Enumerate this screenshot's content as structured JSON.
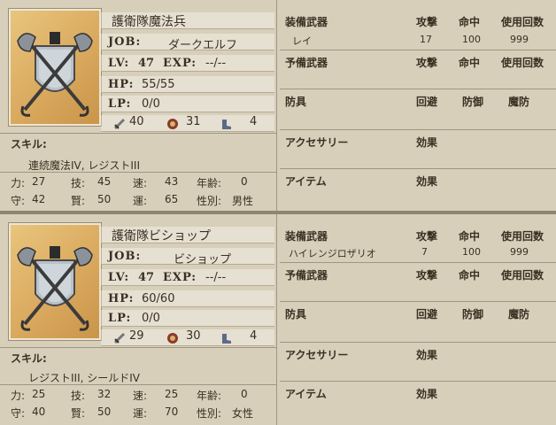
{
  "units": [
    {
      "name": "護衛隊魔法兵",
      "job_label": "JOB:",
      "job": "ダークエルフ",
      "lv_label": "LV:",
      "lv": "47",
      "exp_label": "EXP:",
      "exp": "--/--",
      "hp_label": "HP:",
      "hp": "55/55",
      "lp_label": "LP:",
      "lp": "0/0",
      "atk_icon": "sword-icon",
      "atk": "40",
      "def_icon": "shield-icon",
      "def": "31",
      "move_icon": "boot-icon",
      "move": "4",
      "skill_label": "スキル:",
      "skills": "連続魔法IV, レジストIII",
      "stats": {
        "str_label": "力:",
        "str": "27",
        "tech_label": "技:",
        "tech": "45",
        "spd_label": "速:",
        "spd": "43",
        "age_label": "年齢:",
        "age": "0",
        "def_label": "守:",
        "def": "42",
        "int_label": "賢:",
        "int": "50",
        "luck_label": "運:",
        "luck": "65",
        "sex_label": "性別:",
        "sex": "男性"
      },
      "equip": {
        "weapon_h": "装備武器",
        "atk_h": "攻撃",
        "hit_h": "命中",
        "uses_h": "使用回数",
        "weapon": "レイ",
        "weapon_atk": "17",
        "weapon_hit": "100",
        "weapon_uses": "999",
        "spare_h": "予備武器",
        "spare_atk_h": "攻撃",
        "spare_hit_h": "命中",
        "spare_uses_h": "使用回数",
        "armor_h": "防具",
        "evade_h": "回避",
        "defense_h": "防御",
        "mdef_h": "魔防",
        "acc_h": "アクセサリー",
        "acc_eff_h": "効果",
        "item_h": "アイテム",
        "item_eff_h": "効果"
      }
    },
    {
      "name": "護衛隊ビショップ",
      "job_label": "JOB:",
      "job": "ビショップ",
      "lv_label": "LV:",
      "lv": "47",
      "exp_label": "EXP:",
      "exp": "--/--",
      "hp_label": "HP:",
      "hp": "60/60",
      "lp_label": "LP:",
      "lp": "0/0",
      "atk_icon": "sword-icon",
      "atk": "29",
      "def_icon": "shield-icon",
      "def": "30",
      "move_icon": "boot-icon",
      "move": "4",
      "skill_label": "スキル:",
      "skills": "レジストIII, シールドIV",
      "stats": {
        "str_label": "力:",
        "str": "25",
        "tech_label": "技:",
        "tech": "32",
        "spd_label": "速:",
        "spd": "25",
        "age_label": "年齢:",
        "age": "0",
        "def_label": "守:",
        "def": "40",
        "int_label": "賢:",
        "int": "50",
        "luck_label": "運:",
        "luck": "70",
        "sex_label": "性別:",
        "sex": "女性"
      },
      "equip": {
        "weapon_h": "装備武器",
        "atk_h": "攻撃",
        "hit_h": "命中",
        "uses_h": "使用回数",
        "weapon": "ハイレンジロザリオ",
        "weapon_atk": "7",
        "weapon_hit": "100",
        "weapon_uses": "999",
        "spare_h": "予備武器",
        "spare_atk_h": "攻撃",
        "spare_hit_h": "命中",
        "spare_uses_h": "使用回数",
        "armor_h": "防具",
        "evade_h": "回避",
        "defense_h": "防御",
        "mdef_h": "魔防",
        "acc_h": "アクセサリー",
        "acc_eff_h": "効果",
        "item_h": "アイテム",
        "item_eff_h": "効果"
      }
    }
  ]
}
